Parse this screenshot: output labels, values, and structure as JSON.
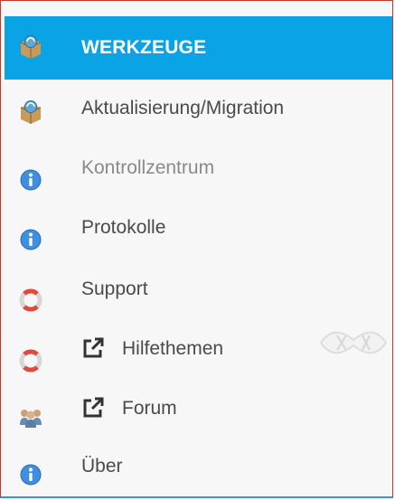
{
  "menu": {
    "title": "WERKZEUGE",
    "items": [
      {
        "label": "Aktualisierung/Migration",
        "icon": "package-icon",
        "external": false
      },
      {
        "label": "Kontrollzentrum",
        "icon": "info-icon",
        "external": false,
        "muted": true
      },
      {
        "label": "Protokolle",
        "icon": "info-icon",
        "external": false
      },
      {
        "label": "Support",
        "icon": "lifebuoy-icon",
        "external": false
      },
      {
        "label": "Hilfethemen",
        "icon": "lifebuoy-icon",
        "external": true
      },
      {
        "label": "Forum",
        "icon": "users-icon",
        "external": true
      },
      {
        "label": "Über",
        "icon": "info-icon",
        "external": false
      }
    ]
  },
  "colors": {
    "header_bg": "#0aa3e6",
    "border": "#c0392b",
    "text": "#4a4a4a",
    "muted_text": "#8a8a8a"
  }
}
